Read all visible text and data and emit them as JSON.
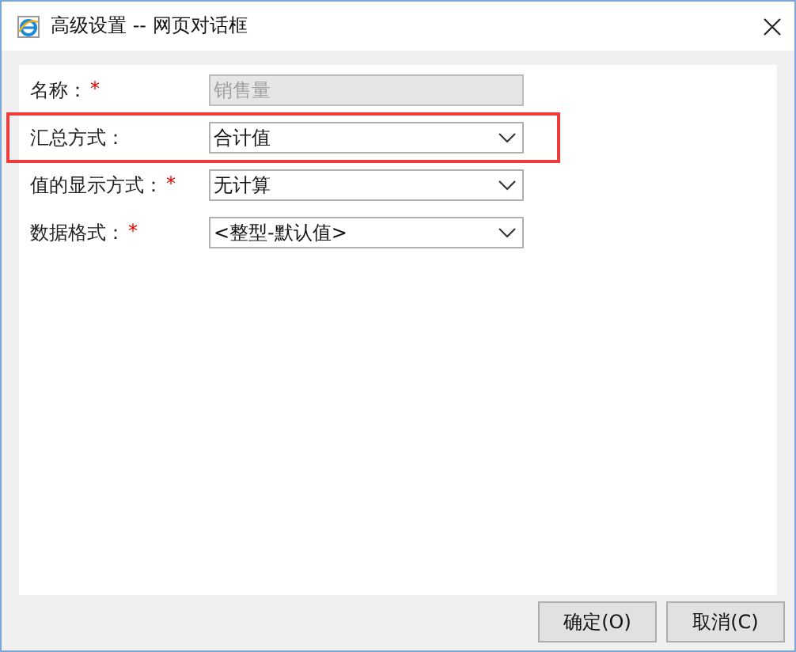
{
  "window": {
    "title": "高级设置 -- 网页对话框"
  },
  "fields": [
    {
      "kind": "text",
      "label": "名称：",
      "required_mark": "*",
      "value": "销售量",
      "disabled": true,
      "highlighted": false
    },
    {
      "kind": "select",
      "label": "汇总方式：",
      "value": "合计值",
      "disabled": false,
      "highlighted": true
    },
    {
      "kind": "select",
      "label": "值的显示方式：",
      "required_mark": "*",
      "value": "无计算",
      "disabled": false,
      "highlighted": false
    },
    {
      "kind": "select",
      "label": "数据格式：",
      "required_mark": "*",
      "value": "<整型-默认值>",
      "disabled": false,
      "highlighted": false
    }
  ],
  "buttons": [
    "确定(O)",
    "取消(C)"
  ]
}
